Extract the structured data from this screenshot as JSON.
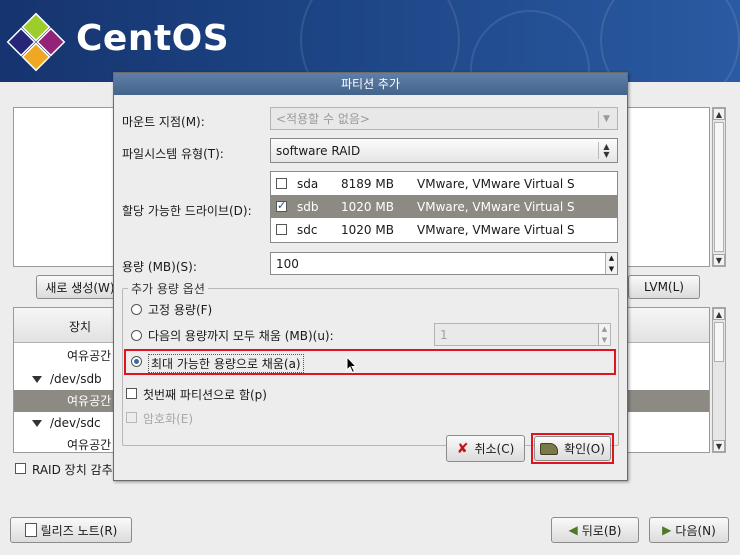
{
  "banner": {
    "brand": "CentOS"
  },
  "main": {
    "create_button": "새로 생성(W)",
    "lvm_button": "LVM(L)",
    "table_header": "장치",
    "rows": [
      {
        "label": "여유공간",
        "indent": 2,
        "selected": false
      },
      {
        "label": "/dev/sdb",
        "indent": 1,
        "selected": false,
        "expandable": true
      },
      {
        "label": "여유공간",
        "indent": 2,
        "selected": true
      },
      {
        "label": "/dev/sdc",
        "indent": 1,
        "selected": false,
        "expandable": true
      },
      {
        "label": "여유공간",
        "indent": 2,
        "selected": false
      }
    ],
    "raid_hide_checkbox": "RAID 장치 감추",
    "release_notes_button": "릴리즈 노트(R)",
    "back_button": "뒤로(B)",
    "next_button": "다음(N)"
  },
  "dialog": {
    "title": "파티션 추가",
    "mount_point_label": "마운트 지점(M):",
    "mount_point_value": "<적용할 수 없음>",
    "fs_type_label": "파일시스템 유형(T):",
    "fs_type_value": "software RAID",
    "drives_label": "할당 가능한 드라이브(D):",
    "drives": [
      {
        "name": "sda",
        "size": "8189 MB",
        "model": "VMware, VMware Virtual S",
        "checked": false,
        "selected": false
      },
      {
        "name": "sdb",
        "size": "1020 MB",
        "model": "VMware, VMware Virtual S",
        "checked": true,
        "selected": true
      },
      {
        "name": "sdc",
        "size": "1020 MB",
        "model": "VMware, VMware Virtual S",
        "checked": false,
        "selected": false
      }
    ],
    "size_label": "용량 (MB)(S):",
    "size_value": "100",
    "options_legend": "추가 용량 옵션",
    "opt_fixed": "고정 용량(F)",
    "opt_fill_upto": "다음의 용량까지 모두 채움 (MB)(u):",
    "opt_fill_upto_value": "1",
    "opt_fill_max": "최대 가능한 용량으로 채움(a)",
    "primary_checkbox": "첫번째 파티션으로 함(p)",
    "encrypt_checkbox": "암호화(E)",
    "cancel_button": "취소(C)",
    "ok_button": "확인(O)"
  },
  "colors": {
    "highlight": "#e0141e",
    "selection": "#8d8a84",
    "title_bar": "#4d6d96"
  }
}
